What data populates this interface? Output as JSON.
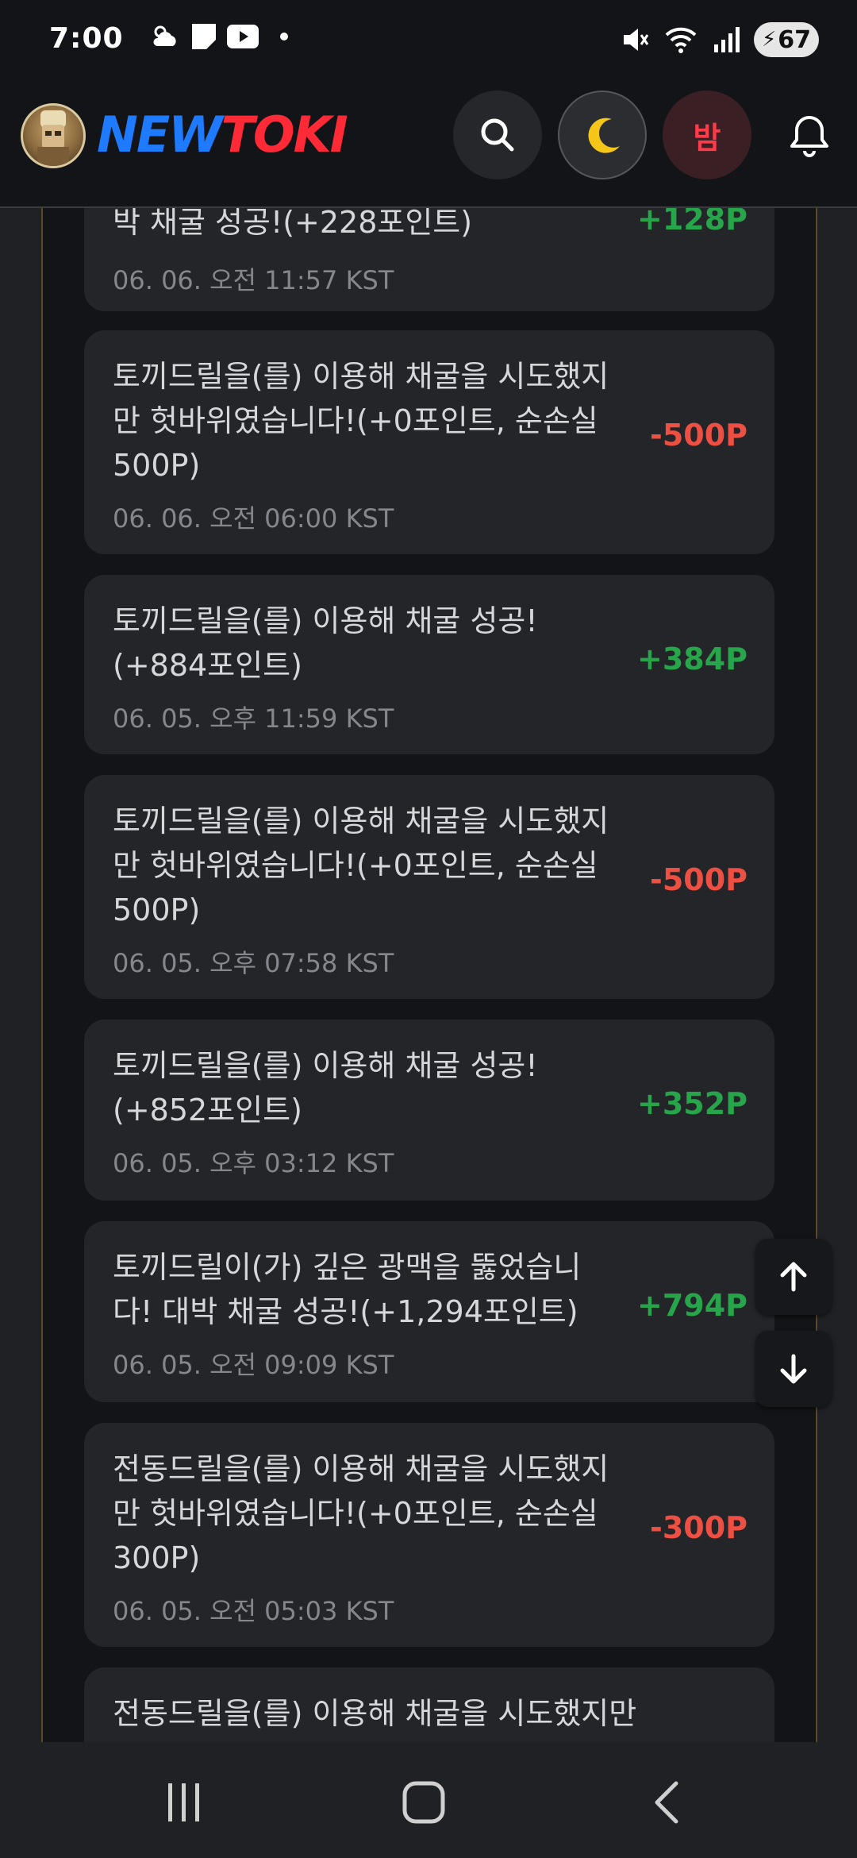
{
  "status_bar": {
    "time": "7:00",
    "battery": "67",
    "icons": [
      "weather-icon",
      "notes-icon",
      "youtube-icon",
      "dot-icon",
      "mute-icon",
      "wifi-icon",
      "signal-icon",
      "battery-icon"
    ]
  },
  "header": {
    "logo_part1": "NEW",
    "logo_part2": "TOKI",
    "night_label": "밤",
    "colors": {
      "logo_blue": "#1e7bff",
      "logo_red": "#ff2a36"
    }
  },
  "history": [
    {
      "text": "박 채굴 성공!(+228포인트)",
      "time": "06. 06. 오전 11:57 KST",
      "points": "+128P",
      "kind": "pos"
    },
    {
      "text": "토끼드릴을(를) 이용해 채굴을 시도했지만 헛바위였습니다!(+0포인트, 순손실 500P)",
      "time": "06. 06. 오전 06:00 KST",
      "points": "-500P",
      "kind": "neg"
    },
    {
      "text": "토끼드릴을(를) 이용해 채굴 성공!(+884포인트)",
      "time": "06. 05. 오후 11:59 KST",
      "points": "+384P",
      "kind": "pos"
    },
    {
      "text": "토끼드릴을(를) 이용해 채굴을 시도했지만 헛바위였습니다!(+0포인트, 순손실 500P)",
      "time": "06. 05. 오후 07:58 KST",
      "points": "-500P",
      "kind": "neg"
    },
    {
      "text": "토끼드릴을(를) 이용해 채굴 성공!(+852포인트)",
      "time": "06. 05. 오후 03:12 KST",
      "points": "+352P",
      "kind": "pos"
    },
    {
      "text": "토끼드릴이(가) 깊은 광맥을 뚫었습니다! 대박 채굴 성공!(+1,294포인트)",
      "time": "06. 05. 오전 09:09 KST",
      "points": "+794P",
      "kind": "pos"
    },
    {
      "text": "전동드릴을(를) 이용해 채굴을 시도했지만 헛바위였습니다!(+0포인트, 순손실 300P)",
      "time": "06. 05. 오전 05:03 KST",
      "points": "-300P",
      "kind": "neg"
    },
    {
      "text": "전동드릴을(를) 이용해 채굴을 시도했지만",
      "time": "",
      "points": "",
      "kind": "neg"
    }
  ]
}
